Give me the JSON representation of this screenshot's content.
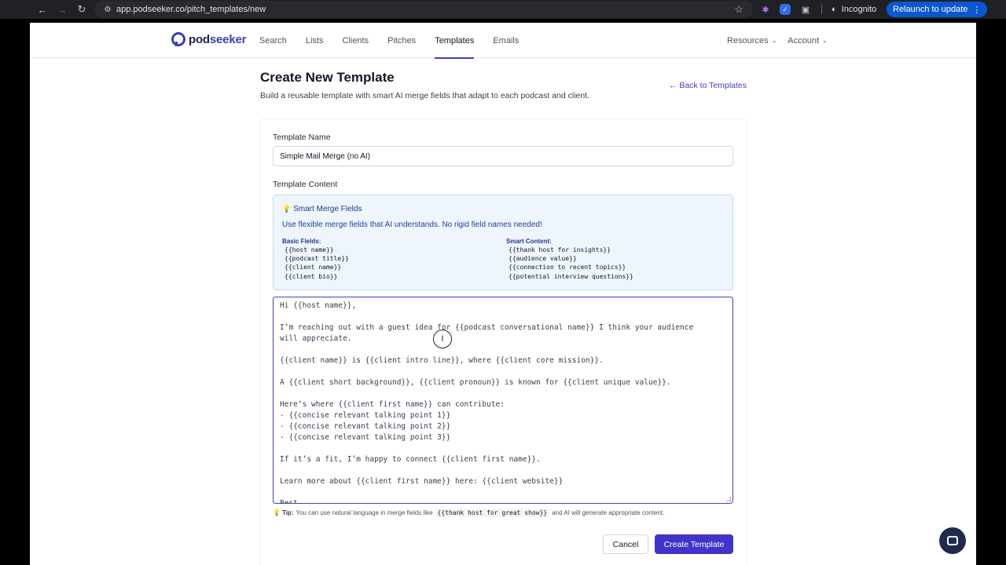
{
  "browser": {
    "url": "app.podseeker.co/pitch_templates/new",
    "incognito_label": "Incognito",
    "relaunch_label": "Relaunch to update"
  },
  "header": {
    "logo_text_main": "pod",
    "logo_text_accent": "seeker",
    "nav": [
      "Search",
      "Lists",
      "Clients",
      "Pitches",
      "Templates",
      "Emails"
    ],
    "active_nav": "Templates",
    "resources_label": "Resources",
    "account_label": "Account"
  },
  "page": {
    "title": "Create New Template",
    "subtitle": "Build a reusable template with smart AI merge fields that adapt to each podcast and client.",
    "back_link": "← Back to Templates"
  },
  "form": {
    "name_label": "Template Name",
    "name_value": "Simple Mail Merge (no AI)",
    "content_label": "Template Content",
    "merge_title": "Smart Merge Fields",
    "merge_desc": "Use flexible merge fields that AI understands. No rigid field names needed!",
    "basic_title": "Basic Fields:",
    "basic_fields": [
      "{{host name}}",
      "{{podcast title}}",
      "{{client name}}",
      "{{client bio}}"
    ],
    "smart_title": "Smart Content:",
    "smart_fields": [
      "{{thank host for insights}}",
      "{{audience value}}",
      "{{connection to recent topics}}",
      "{{potential interview questions}}"
    ],
    "content_lines": [
      "Hi {{host name}},",
      "",
      "I’m reaching out with a guest idea for {{podcast conversational name}} I think your audience",
      "will appreciate.",
      "",
      "{{client name}} is {{client intro line}}, where {{client core mission}}.",
      "",
      "A {{client short background}}, {{client pronoun}} is known for {{client unique value}}.",
      "",
      "Here’s where {{client first name}} can contribute:",
      "- {{concise relevant talking point 1}}",
      "- {{concise relevant talking point 2}}",
      "- {{concise relevant talking point 3}}",
      "",
      "If it’s a fit, I’m happy to connect {{client first name}}.",
      "",
      "Learn more about {{client first name}} here: {{client website}}",
      "",
      "Best,"
    ],
    "tip_label": "Tip:",
    "tip_text_before": "You can use natural language in merge fields like",
    "tip_code": "{{thank host for great show}}",
    "tip_text_after": "and AI will generate appropriate content.",
    "cancel_label": "Cancel",
    "create_label": "Create Template"
  },
  "colors": {
    "accent": "#4333c8",
    "merge_bg": "#eef5fc"
  }
}
